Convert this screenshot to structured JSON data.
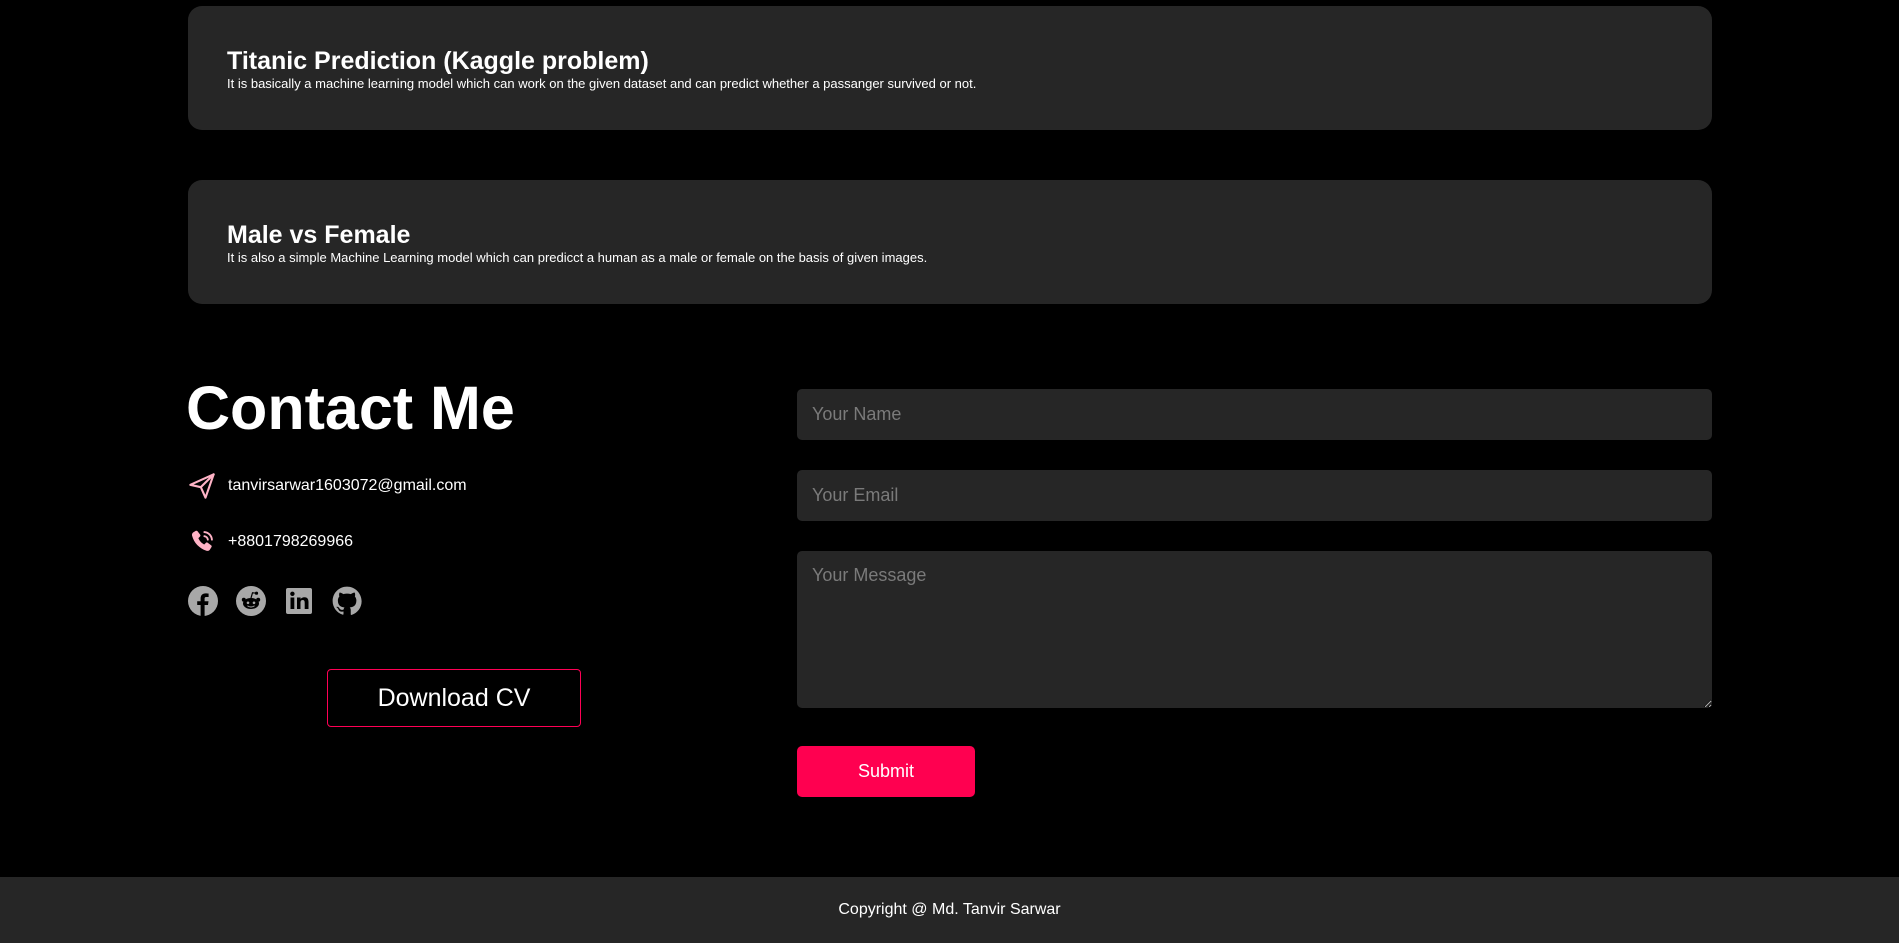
{
  "projects": [
    {
      "title": "Titanic Prediction (Kaggle problem)",
      "description": "It is basically a machine learning model which can work on the given dataset and can predict whether a passanger survived or not."
    },
    {
      "title": "Male vs Female",
      "description": "It is also a simple Machine Learning model which can predicct a human as a male or female on the basis of given images."
    }
  ],
  "contact": {
    "title": "Contact Me",
    "email": "tanvirsarwar1603072@gmail.com",
    "phone": "+8801798269966",
    "email_icon": "paper-plane-icon",
    "phone_icon": "phone-icon",
    "socials": [
      "facebook-icon",
      "reddit-icon",
      "linkedin-icon",
      "github-icon"
    ],
    "download_label": "Download CV"
  },
  "form": {
    "name_placeholder": "Your Name",
    "email_placeholder": "Your Email",
    "message_placeholder": "Your Message",
    "submit_label": "Submit"
  },
  "footer": {
    "copyright": "Copyright @ Md. Tanvir Sarwar"
  },
  "colors": {
    "background": "#000000",
    "card": "#262626",
    "accent": "#ff0050",
    "icon_pink": "#ffb3c6",
    "social_gray": "#a8a8a8"
  }
}
